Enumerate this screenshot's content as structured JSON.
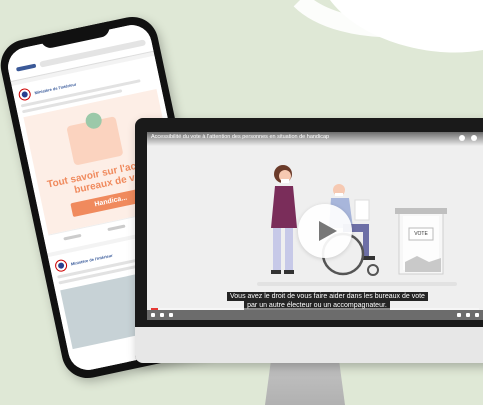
{
  "phone": {
    "post1": {
      "page_name": "Ministère de l'intérieur",
      "text": "Ministère de l'intérieur"
    },
    "card": {
      "title": "Tout savoir sur l'accès des bureaux de vote",
      "button": "Handica..."
    },
    "post2": {
      "page_name": "Ministère de l'intérieur"
    }
  },
  "video": {
    "title": "Accessibilité du vote à l'attention des personnes en situation de handicap",
    "ballot_label": "VOTE",
    "subtitle_line1": "Vous avez le droit de vous faire aider dans les bureaux de vote",
    "subtitle_line2": "par un autre électeur ou un accompagnateur.",
    "progress": 0.02
  },
  "colors": {
    "background": "#dfe8d6",
    "accent_orange": "#f08a5d",
    "woman_top": "#7a2d5a",
    "progress_red": "#e53935"
  }
}
